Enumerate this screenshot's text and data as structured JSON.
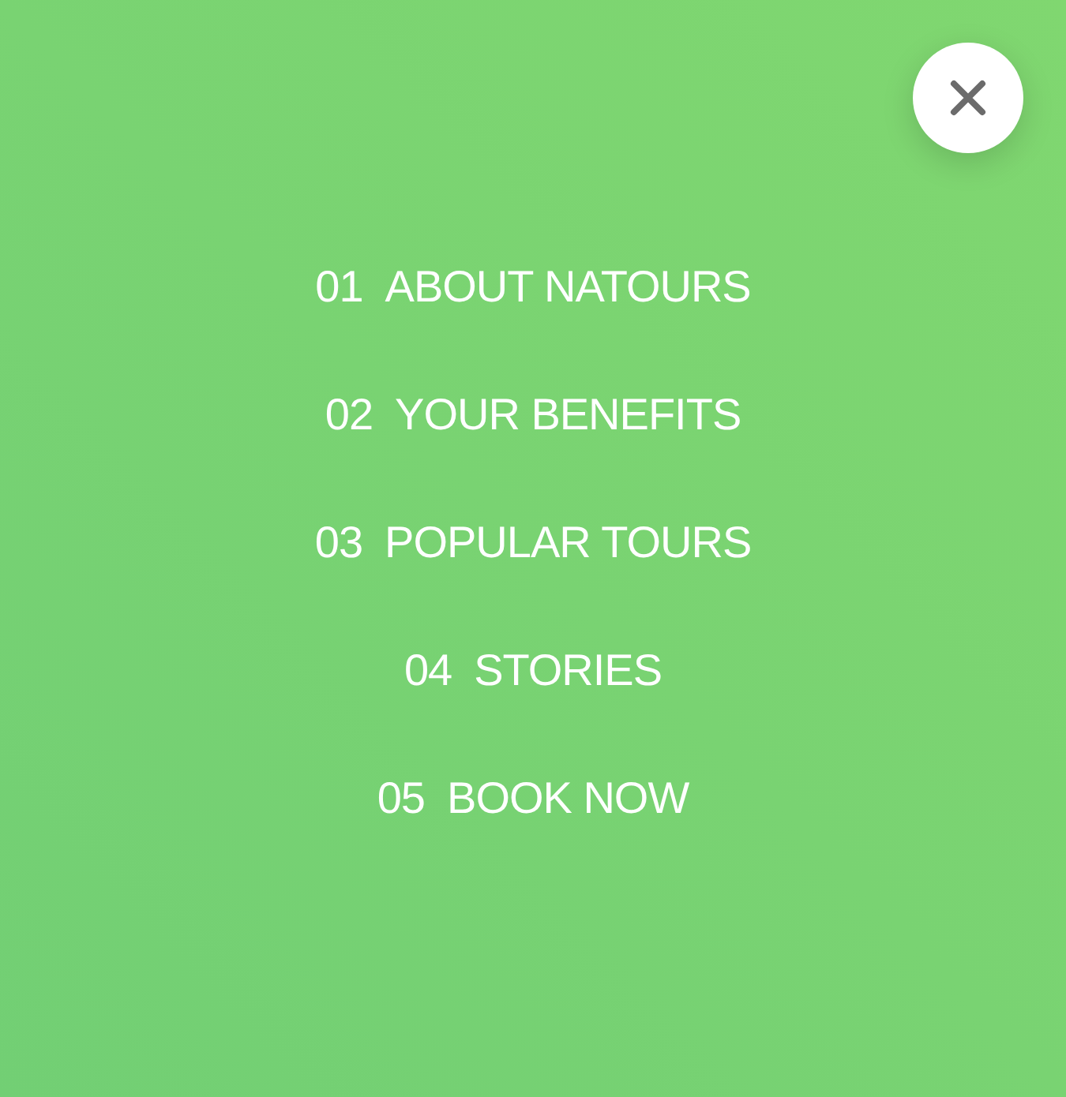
{
  "nav": {
    "items": [
      {
        "number": "01",
        "label": "ABOUT NATOURS"
      },
      {
        "number": "02",
        "label": "YOUR BENEFITS"
      },
      {
        "number": "03",
        "label": "POPULAR TOURS"
      },
      {
        "number": "04",
        "label": "STORIES"
      },
      {
        "number": "05",
        "label": "BOOK NOW"
      }
    ]
  }
}
